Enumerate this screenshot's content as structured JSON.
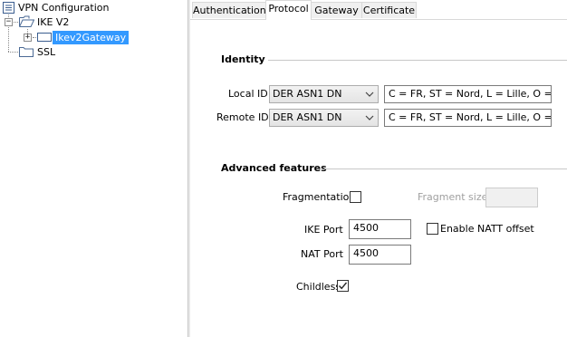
{
  "tree": {
    "root": "VPN Configuration",
    "ikev2": "IKE V2",
    "gateway": "Ikev2Gateway",
    "ssl": "SSL",
    "expander_symbol": "+"
  },
  "tabs": [
    "Authentication",
    "Protocol",
    "Gateway",
    "Certificate"
  ],
  "active_tab": "Protocol",
  "identity": {
    "title": "Identity",
    "local_id_label": "Local ID",
    "local_id_type": "DER ASN1 DN",
    "local_id_value": "C = FR, ST = Nord, L = Lille, O = Stc",
    "remote_id_label": "Remote ID",
    "remote_id_type": "DER ASN1 DN",
    "remote_id_value": "C = FR, ST = Nord, L = Lille, O = Stc"
  },
  "advanced": {
    "title": "Advanced features",
    "fragmentation_label": "Fragmentation",
    "fragmentation_checked": false,
    "fragment_size_label": "Fragment size",
    "fragment_size_value": "",
    "ike_port_label": "IKE Port",
    "ike_port_value": "4500",
    "nat_port_label": "NAT Port",
    "nat_port_value": "4500",
    "natt_offset_label": "Enable NATT offset",
    "natt_offset_checked": false,
    "childless_label": "Childless",
    "childless_checked": true
  },
  "colors": {
    "selection": "#3399ff",
    "tab_inactive": "#f0f0f0",
    "border": "#d9d9d9"
  }
}
